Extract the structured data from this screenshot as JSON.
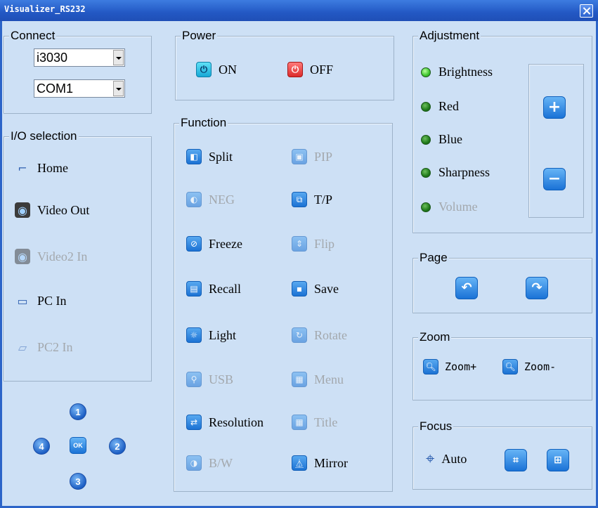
{
  "window": {
    "title": "Visualizer_RS232"
  },
  "connect": {
    "legend": "Connect",
    "model": "i3030",
    "port": "COM1"
  },
  "io": {
    "legend": "I/O selection",
    "items": [
      {
        "label": "Home",
        "enabled": true,
        "icon": "document-camera-icon"
      },
      {
        "label": "Video Out",
        "enabled": true,
        "icon": "camera-icon"
      },
      {
        "label": "Video2 In",
        "enabled": false,
        "icon": "camera-icon"
      },
      {
        "label": "PC In",
        "enabled": true,
        "icon": "computer-icon"
      },
      {
        "label": "PC2 In",
        "enabled": false,
        "icon": "laptop-icon"
      }
    ]
  },
  "keypad": {
    "b1": "1",
    "b2": "2",
    "b3": "3",
    "b4": "4",
    "ok": "OK"
  },
  "power": {
    "legend": "Power",
    "on": "ON",
    "off": "OFF"
  },
  "function": {
    "legend": "Function",
    "items": [
      {
        "label": "Split",
        "enabled": true
      },
      {
        "label": "PIP",
        "enabled": false
      },
      {
        "label": "NEG",
        "enabled": false
      },
      {
        "label": "T/P",
        "enabled": true
      },
      {
        "label": "Freeze",
        "enabled": true
      },
      {
        "label": "Flip",
        "enabled": false
      },
      {
        "label": "Recall",
        "enabled": true
      },
      {
        "label": "Save",
        "enabled": true
      },
      {
        "label": "Light",
        "enabled": true
      },
      {
        "label": "Rotate",
        "enabled": false
      },
      {
        "label": "USB",
        "enabled": false
      },
      {
        "label": "Menu",
        "enabled": false
      },
      {
        "label": "Resolution",
        "enabled": true
      },
      {
        "label": "Title",
        "enabled": false
      },
      {
        "label": "B/W",
        "enabled": false
      },
      {
        "label": "Mirror",
        "enabled": true
      }
    ]
  },
  "adjustment": {
    "legend": "Adjustment",
    "items": [
      {
        "label": "Brightness",
        "state": "active"
      },
      {
        "label": "Red",
        "state": "on"
      },
      {
        "label": "Blue",
        "state": "on"
      },
      {
        "label": "Sharpness",
        "state": "on"
      },
      {
        "label": "Volume",
        "state": "disabled"
      }
    ],
    "plus": "+",
    "minus": "−"
  },
  "page": {
    "legend": "Page"
  },
  "zoom": {
    "legend": "Zoom",
    "in": "Zoom+",
    "out": "Zoom-"
  },
  "focus": {
    "legend": "Focus",
    "auto": "Auto"
  }
}
